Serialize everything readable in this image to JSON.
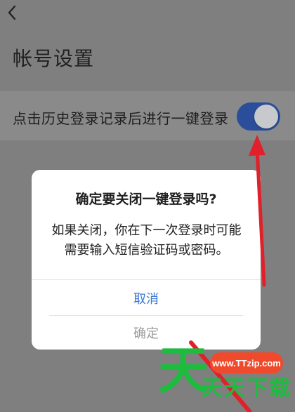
{
  "header": {
    "title": "帐号设置"
  },
  "settings": {
    "one_click_login_label": "点击历史登录记录后进行一键登录",
    "one_click_login_enabled": true
  },
  "dialog": {
    "title": "确定要关闭一键登录吗?",
    "message": "如果关闭，你在下一次登录时可能需要输入短信验证码或密码。",
    "cancel_label": "取消",
    "confirm_label": "确定"
  },
  "watermark": {
    "url": "www.TTzip.com",
    "text": "天天下载"
  },
  "colors": {
    "accent": "#3a79d4",
    "toggle_on": "#2a4e9a",
    "arrow": "#e0202a",
    "watermark_green": "#1dbb3e",
    "watermark_red": "#f04a2c"
  }
}
